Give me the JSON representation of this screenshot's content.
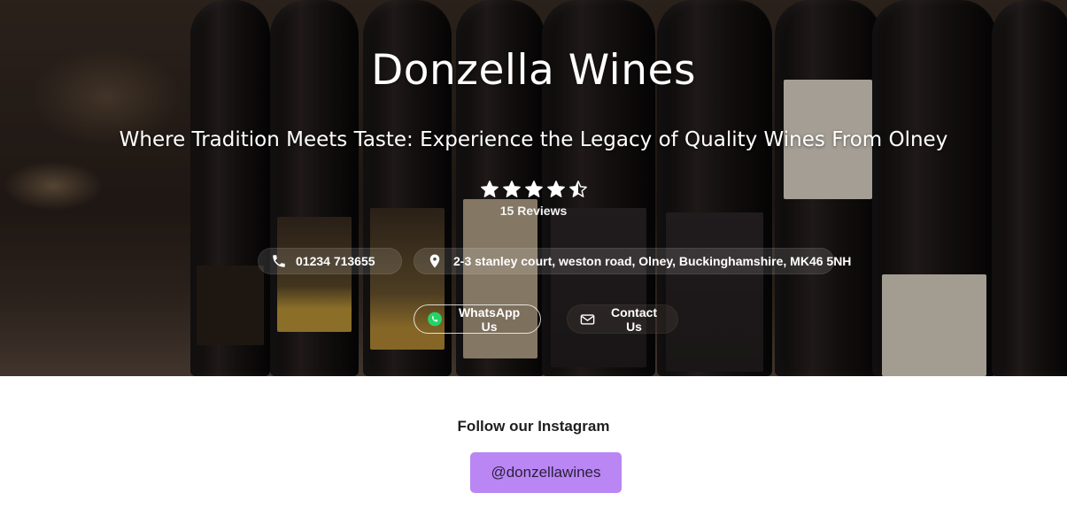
{
  "hero": {
    "title": "Donzella Wines",
    "tagline": "Where Tradition Meets Taste: Experience the Legacy of Quality Wines From Olney",
    "rating": 4.5,
    "reviews_label": "15 Reviews",
    "phone": {
      "icon": "phone-icon",
      "label": "01234 713655"
    },
    "address": {
      "icon": "location-pin-icon",
      "label": "2-3 stanley court, weston road, Olney, Buckinghamshire, MK46 5NH"
    },
    "whatsapp": {
      "icon": "whatsapp-icon",
      "label": "WhatsApp Us",
      "icon_color": "#25d366"
    },
    "contact": {
      "icon": "mail-icon",
      "label": "Contact Us"
    }
  },
  "instagram": {
    "heading": "Follow our Instagram",
    "handle": "@donzellawines",
    "button_color": "#b986f4"
  }
}
